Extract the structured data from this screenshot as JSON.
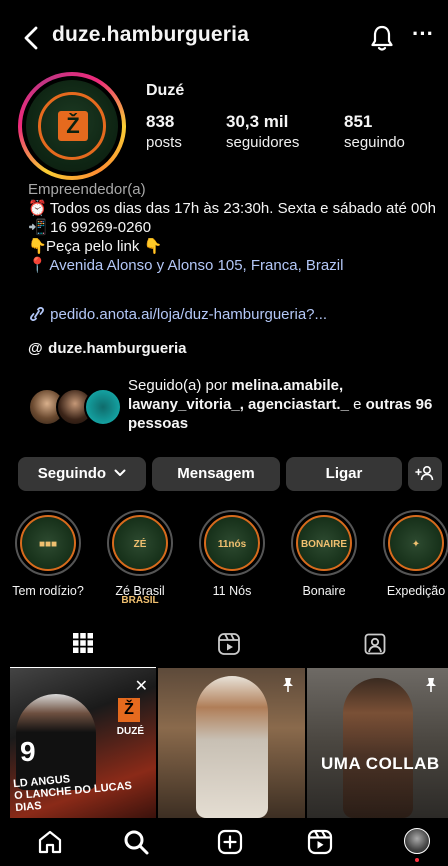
{
  "header": {
    "username": "duze.hamburgueria"
  },
  "profile": {
    "display_name": "Duzé",
    "stats": [
      {
        "value": "838",
        "label": "posts"
      },
      {
        "value": "30,3 mil",
        "label": "seguidores"
      },
      {
        "value": "851",
        "label": "seguindo"
      }
    ],
    "category": "Empreendedor(a)",
    "bio_hours": "Todos os dias das 17h às 23:30h. Sexta e sábado até 00h",
    "bio_phone": "16 99269-0260",
    "bio_order": "Peça pelo link",
    "address": "Avenida Alonso y Alonso 105, Franca, Brazil",
    "url": "pedido.anota.ai/loja/duz-hamburgueria?...",
    "threads_handle": "duze.hamburgueria",
    "avatar_letter": "Ž"
  },
  "followed_by": {
    "prefix": "Seguido(a) por ",
    "names": "melina.amabile, lawany_vitoria_, agenciastart._",
    "middle": " e ",
    "others": "outras 96 pessoas"
  },
  "actions": {
    "following_label": "Seguindo",
    "message_label": "Mensagem",
    "call_label": "Ligar"
  },
  "highlights": [
    {
      "caption": "Tem rodízio?",
      "inner": "■■■"
    },
    {
      "caption": "Zé Brasil",
      "inner": "ZÉ BRASIL"
    },
    {
      "caption": "11 Nós",
      "inner": "11nós"
    },
    {
      "caption": "Bonaire",
      "inner": "BONAIRE"
    },
    {
      "caption": "Expedição",
      "inner": "✦"
    }
  ],
  "posts": [
    {
      "badge": "Ž",
      "brand": "DUZÉ",
      "jersey": "9",
      "headline": "LD ANGUS\nO LANCHE DO LUCAS DIAS"
    },
    {
      "pinned": true
    },
    {
      "caption": "UMA COLLAB"
    }
  ],
  "colors": {
    "background": "#000000",
    "button": "#363636",
    "link": "#b3c7f7",
    "brand_orange": "#e56a1e",
    "brand_green": "#163019"
  }
}
